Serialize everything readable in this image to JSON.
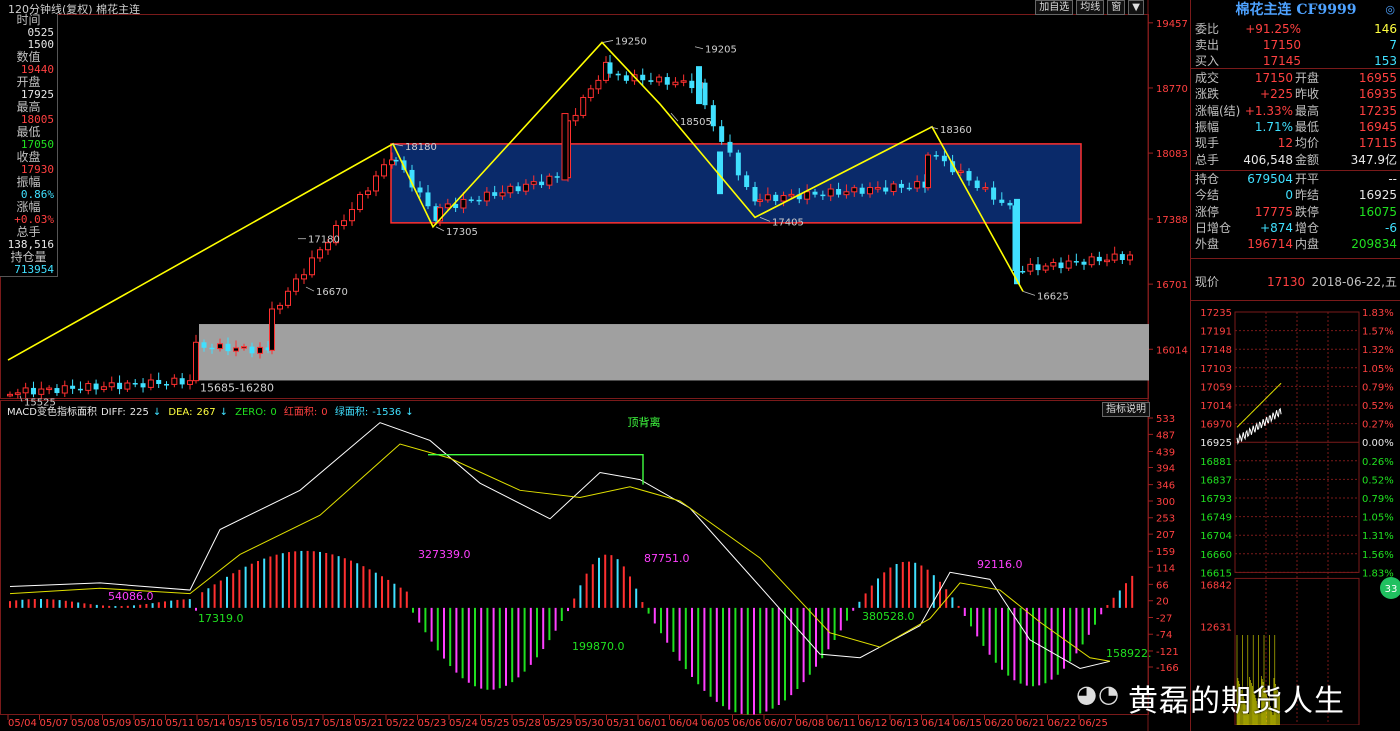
{
  "window": {
    "title": "120分钟线(复权) 棉花主连",
    "buttons": [
      "加自选",
      "均线",
      "窗",
      "▼"
    ]
  },
  "left_panel": [
    {
      "label": "时间",
      "value": "0525",
      "value2": "1500",
      "color": "#e8e8e8"
    },
    {
      "label": "数值",
      "value": "19440",
      "color": "#ff4040"
    },
    {
      "label": "开盘",
      "value": "17925",
      "color": "#e8e8e8"
    },
    {
      "label": "最高",
      "value": "18005",
      "color": "#ff4040"
    },
    {
      "label": "最低",
      "value": "17050",
      "color": "#20e020"
    },
    {
      "label": "收盘",
      "value": "17930",
      "color": "#ff4040"
    },
    {
      "label": "振幅",
      "value": "0.86%",
      "color": "#40e0ff"
    },
    {
      "label": "涨幅",
      "value": "+0.03%",
      "color": "#ff4040"
    },
    {
      "label": "总手",
      "value": "138,516",
      "color": "#e8e8e8"
    },
    {
      "label": "持仓量",
      "value": "713954",
      "color": "#40e0ff"
    }
  ],
  "price_axis": [
    "19457",
    "18770",
    "18083",
    "17388",
    "16701",
    "16014"
  ],
  "annotations": {
    "box_range": "15685-16280",
    "pivots": [
      "19250",
      "19205",
      "18180",
      "18505",
      "18360",
      "17305",
      "17405",
      "17180",
      "16670",
      "16625",
      "15525"
    ]
  },
  "macd": {
    "header": {
      "name": "MACD变色指标面积",
      "diff_label": "DIFF:",
      "diff": "225",
      "dea_label": "DEA:",
      "dea": "267",
      "zero_label": "ZERO:",
      "zero": "0",
      "red_label": "红面积:",
      "red": "0",
      "green_label": "绿面积:",
      "green": "-1536"
    },
    "button": "指标说明",
    "divergence_label": "顶背离",
    "areas": [
      "54086.0",
      "17319.0",
      "327339.0",
      "199870.0",
      "87751.0",
      "380528.0",
      "92116.0",
      "158922."
    ],
    "axis": [
      "533",
      "487",
      "439",
      "394",
      "346",
      "300",
      "253",
      "207",
      "159",
      "114",
      "66",
      "20",
      "-27",
      "-74",
      "-121",
      "-166"
    ]
  },
  "dates": [
    "05/04",
    "05/07",
    "05/08",
    "05/09",
    "05/10",
    "05/11",
    "05/14",
    "05/15",
    "05/16",
    "05/17",
    "05/18",
    "05/21",
    "05/22",
    "05/23",
    "05/24",
    "05/25",
    "05/28",
    "05/29",
    "05/30",
    "05/31",
    "06/01",
    "06/04",
    "06/05",
    "06/06",
    "06/07",
    "06/08",
    "06/11",
    "06/12",
    "06/13",
    "06/14",
    "06/15",
    "06/20",
    "06/21",
    "06/22",
    "06/25"
  ],
  "quote": {
    "title": "棉花主连 CF9999",
    "rows": [
      {
        "l": "委比",
        "v": "+91.25%",
        "v2": "146",
        "lc": "grey",
        "vc": "red",
        "v2c": "yellow"
      },
      {
        "l": "卖出",
        "v": "17150",
        "v2": "7",
        "lc": "grey",
        "vc": "red",
        "v2c": "cyan"
      },
      {
        "l": "买入",
        "v": "17145",
        "v2": "153",
        "lc": "grey",
        "vc": "red",
        "v2c": "cyan"
      }
    ],
    "grid": [
      {
        "l1": "成交",
        "v1": "17150",
        "l2": "开盘",
        "v2": "16955",
        "c1": "red",
        "c2": "red"
      },
      {
        "l1": "涨跌",
        "v1": "+225",
        "l2": "昨收",
        "v2": "16935",
        "c1": "red",
        "c2": "red"
      },
      {
        "l1": "涨幅(结)",
        "v1": "+1.33%",
        "l2": "最高",
        "v2": "17235",
        "c1": "red",
        "c2": "red"
      },
      {
        "l1": "振幅",
        "v1": "1.71%",
        "l2": "最低",
        "v2": "16945",
        "c1": "cyan",
        "c2": "red"
      },
      {
        "l1": "现手",
        "v1": "12",
        "l2": "均价",
        "v2": "17115",
        "c1": "red",
        "c2": "red"
      },
      {
        "l1": "总手",
        "v1": "406,548",
        "l2": "金额",
        "v2": "347.9亿",
        "c1": "white",
        "c2": "white"
      }
    ],
    "grid2": [
      {
        "l1": "持仓",
        "v1": "679504",
        "l2": "开平",
        "v2": "--",
        "c1": "cyan",
        "c2": "white"
      },
      {
        "l1": "今结",
        "v1": "0",
        "l2": "昨结",
        "v2": "16925",
        "c1": "cyan",
        "c2": "white"
      },
      {
        "l1": "涨停",
        "v1": "17775",
        "l2": "跌停",
        "v2": "16075",
        "c1": "red",
        "c2": "green"
      },
      {
        "l1": "日增仓",
        "v1": "+874",
        "l2": "增仓",
        "v2": "-6",
        "c1": "cyan",
        "c2": "cyan"
      },
      {
        "l1": "外盘",
        "v1": "196714",
        "l2": "内盘",
        "v2": "209834",
        "c1": "red",
        "c2": "green"
      }
    ],
    "current_label": "现价",
    "current": "17130",
    "date": "2018-06-22,五",
    "mini_prices": [
      "17235",
      "17191",
      "17148",
      "17103",
      "17059",
      "17014",
      "16970",
      "16925",
      "16881",
      "16837",
      "16793",
      "16749",
      "16704",
      "16660",
      "16615"
    ],
    "mini_pcts": [
      "1.83%",
      "1.57%",
      "1.32%",
      "1.05%",
      "0.79%",
      "0.52%",
      "0.27%",
      "0.00%",
      "0.26%",
      "0.52%",
      "0.79%",
      "1.05%",
      "1.31%",
      "1.56%",
      "1.83%"
    ],
    "vol_labels": [
      "16842",
      "12631"
    ],
    "badge": "33"
  },
  "watermark": "黄磊的期货人生",
  "colors": {
    "up": "#ff3030",
    "down": "#40e0ff",
    "zigzag": "#ffff00",
    "box_fill": "#0a2a6a",
    "box_border": "#ff3030",
    "grey_box": "#a0a0a0",
    "diff_line": "#ffffff",
    "dea_line": "#e0e000",
    "green_bar": "#20e020",
    "magenta_bar": "#ff40ff"
  }
}
